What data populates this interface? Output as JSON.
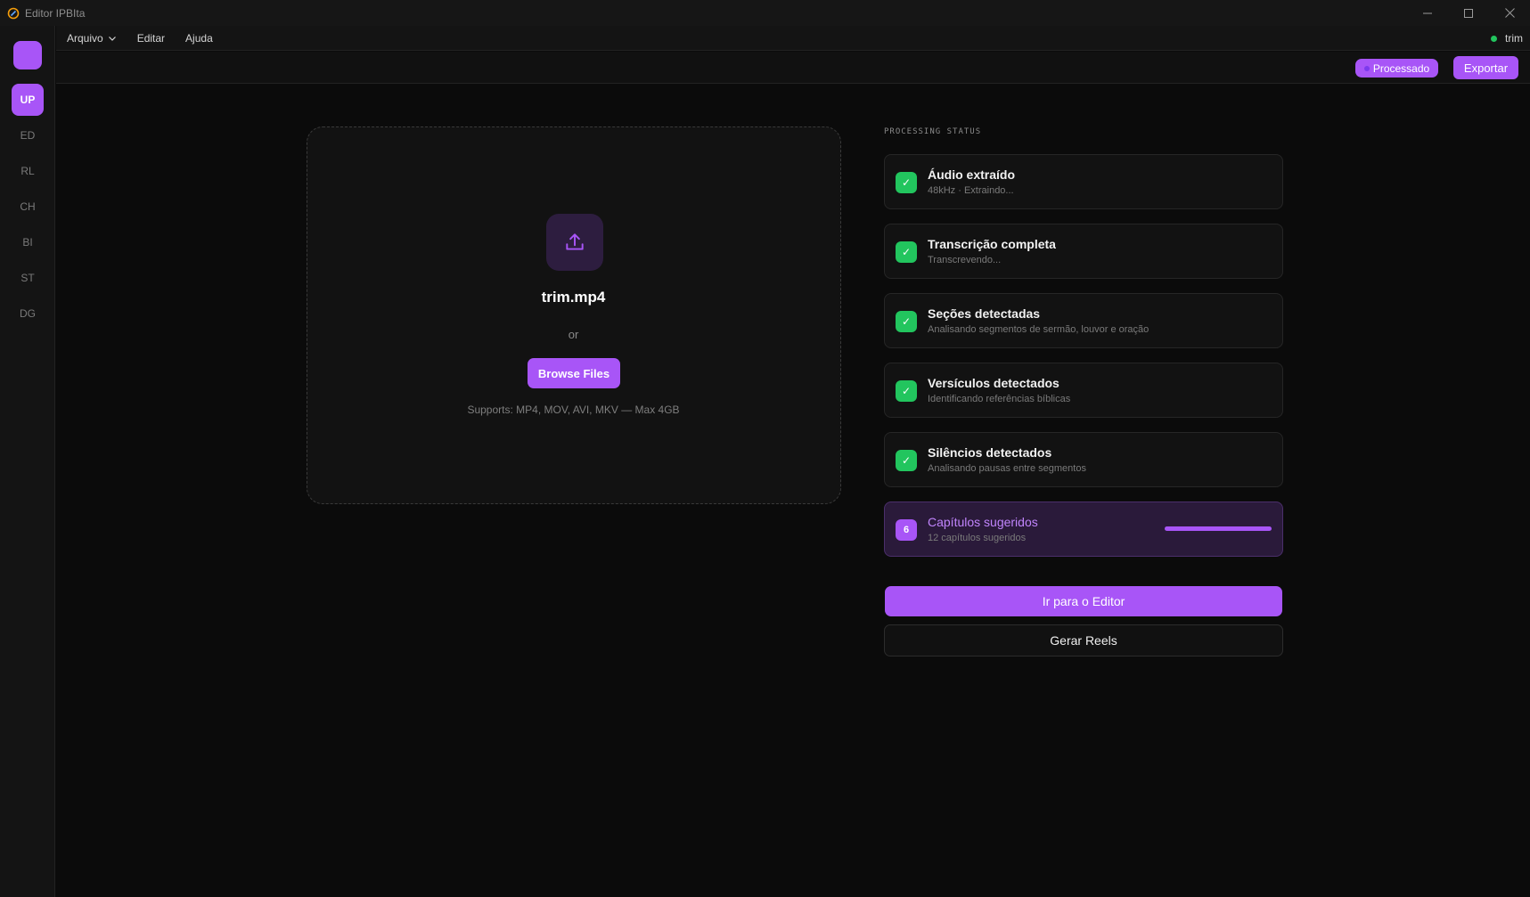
{
  "window": {
    "title": "Editor IPBIta"
  },
  "sidebar": {
    "items": [
      {
        "label": "UP",
        "active": true
      },
      {
        "label": "ED"
      },
      {
        "label": "RL"
      },
      {
        "label": "CH"
      },
      {
        "label": "BI"
      },
      {
        "label": "ST"
      },
      {
        "label": "DG"
      }
    ]
  },
  "menu": {
    "arquivo": "Arquivo",
    "editar": "Editar",
    "ajuda": "Ajuda"
  },
  "user": {
    "name": "trim",
    "status_color": "#22c55e"
  },
  "toolbar": {
    "status_badge": "Processado",
    "export_label": "Exportar"
  },
  "upload": {
    "file_name": "trim.mp4",
    "or_text": "or",
    "browse_label": "Browse Files",
    "supports_text": "Supports: MP4, MOV, AVI, MKV — Max 4GB"
  },
  "processing": {
    "label": "PROCESSING STATUS",
    "steps": [
      {
        "title": "Áudio extraído",
        "subtitle": "48kHz · Extraindo...",
        "status": "done"
      },
      {
        "title": "Transcrição completa",
        "subtitle": "Transcrevendo...",
        "status": "done"
      },
      {
        "title": "Seções detectadas",
        "subtitle": "Analisando segmentos de sermão, louvor e oração",
        "status": "done"
      },
      {
        "title": "Versículos detectados",
        "subtitle": "Identificando referências bíblicas",
        "status": "done"
      },
      {
        "title": "Silêncios detectados",
        "subtitle": "Analisando pausas entre segmentos",
        "status": "done"
      },
      {
        "title": "Capítulos sugeridos",
        "subtitle": "12 capítulos sugeridos",
        "status": "active",
        "number": "6",
        "progress": 1.0
      }
    ]
  },
  "actions": {
    "primary": "Ir para o Editor",
    "secondary": "Gerar Reels"
  },
  "colors": {
    "accent": "#a855f7",
    "success": "#22c55e",
    "background": "#0b0b0b"
  }
}
